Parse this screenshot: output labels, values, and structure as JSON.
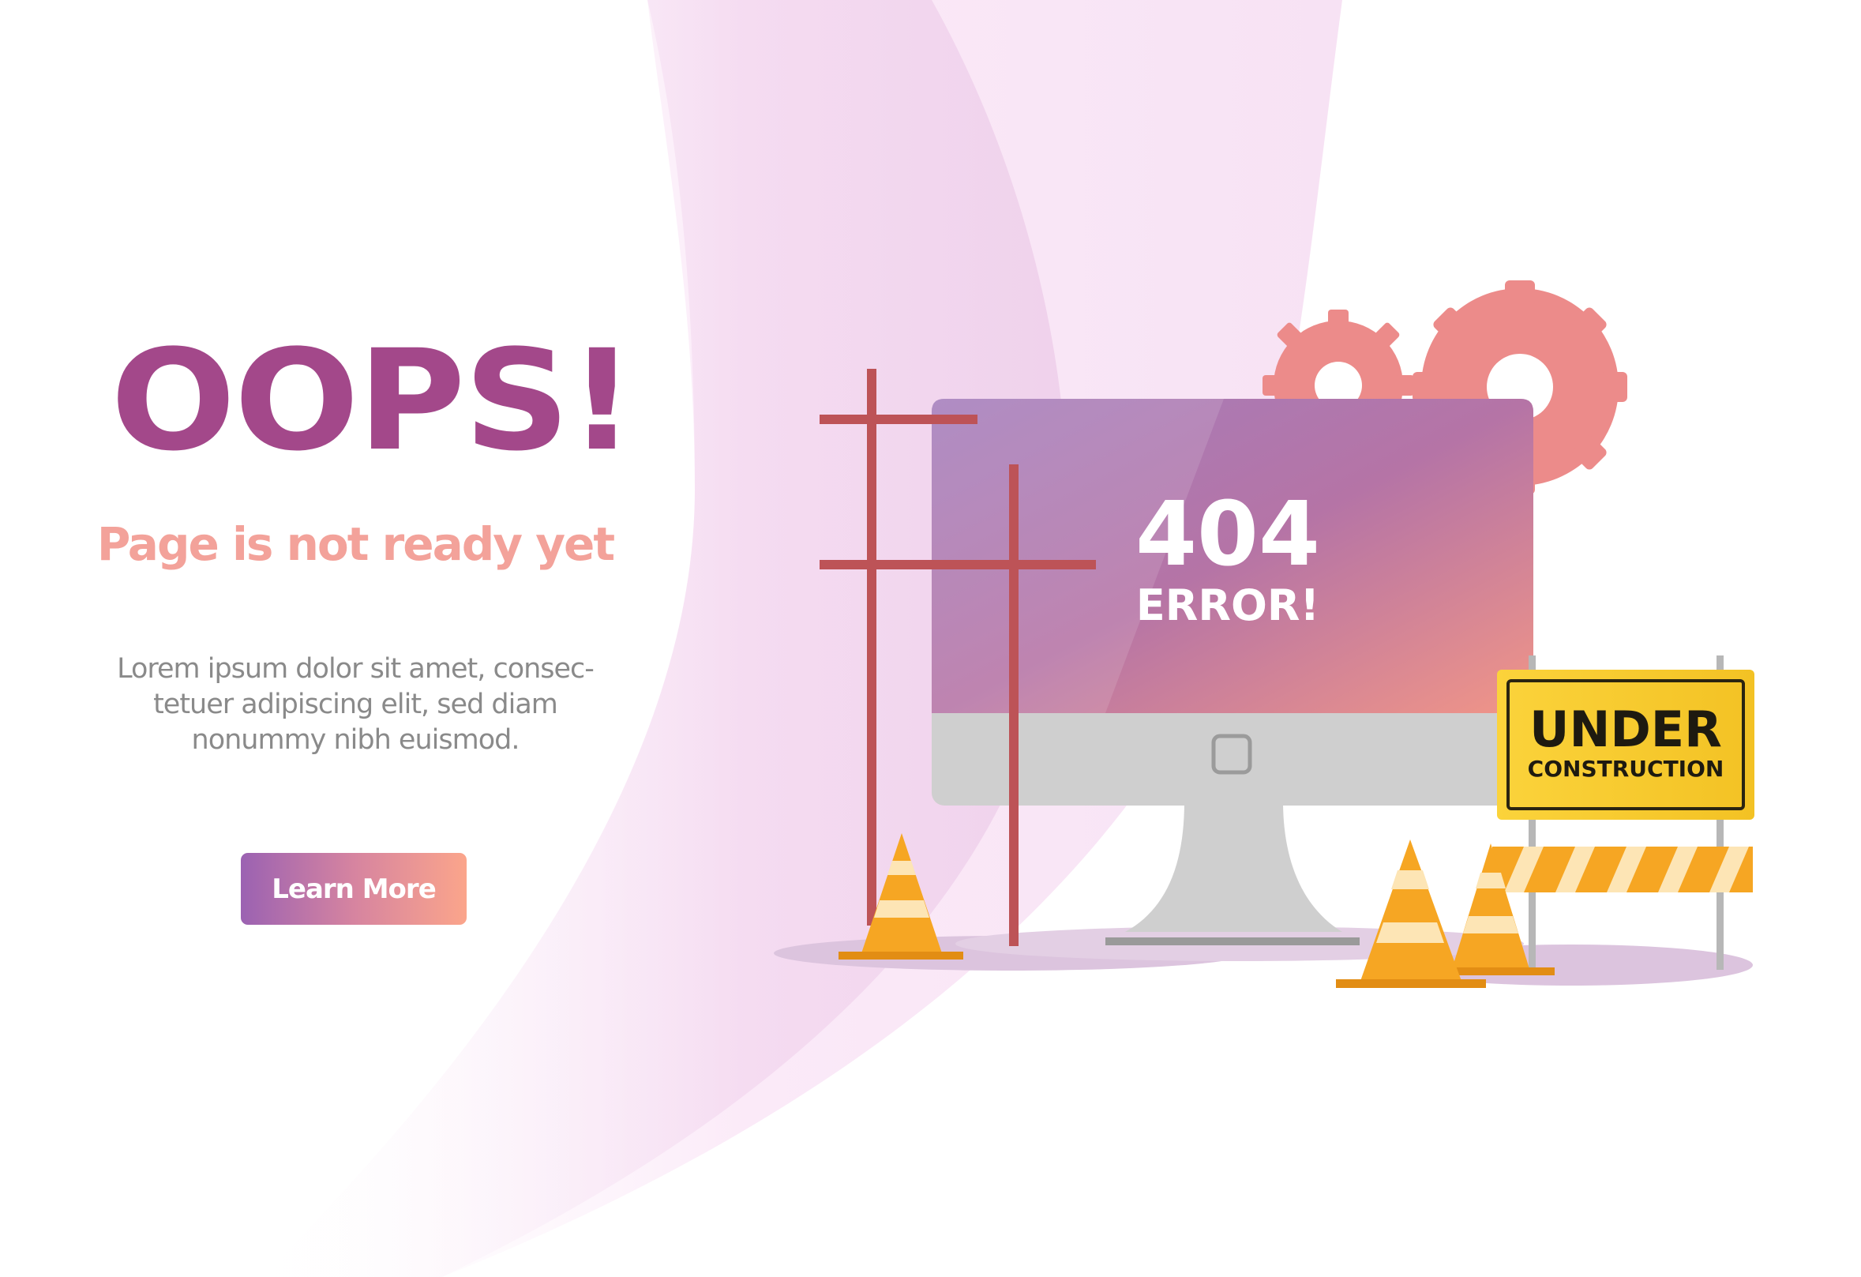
{
  "hero": {
    "title": "OOPS!",
    "subtitle": "Page is not ready yet",
    "body_lines": [
      "Lorem ipsum dolor sit amet, consec-",
      "tetuer adipiscing elit, sed diam",
      "nonummy nibh euismod."
    ],
    "cta_label": "Learn More"
  },
  "illustration": {
    "monitor": {
      "screen_line1": "404",
      "screen_line2": "ERROR!"
    },
    "sign": {
      "line1": "UNDER",
      "line2": "CONSTRUCTION"
    }
  },
  "colors": {
    "brand_purple": "#a3488a",
    "accent_salmon": "#f3a29a",
    "body_gray": "#8a8a8a",
    "sign_yellow": "#fbd33b",
    "cone_orange": "#f6a623",
    "pole_red": "#bd5357"
  },
  "icons": [
    "gear-icon",
    "monitor-icon",
    "traffic-cone-icon",
    "utility-pole-icon",
    "barricade-icon",
    "sign-icon"
  ]
}
